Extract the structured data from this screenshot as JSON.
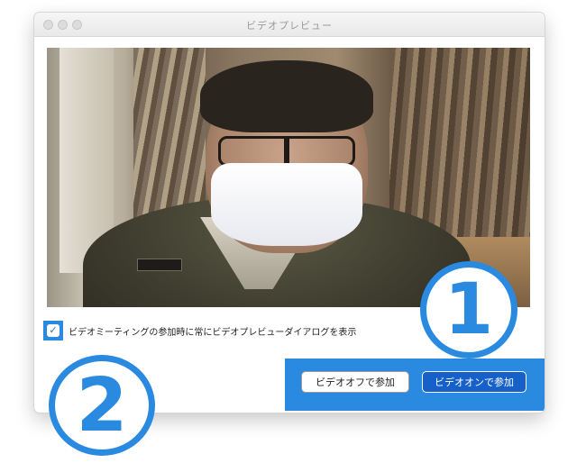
{
  "window": {
    "title": "ビデオプレビュー"
  },
  "preview": {
    "option_label": "ビデオミーティングの参加時に常にビデオプレビューダイアログを表示",
    "checked": true
  },
  "buttons": {
    "off_label": "ビデオオフで参加",
    "on_label": "ビデオオンで参加"
  },
  "callouts": {
    "one": "1",
    "two": "2",
    "accent": "#2a8ae0"
  },
  "icons": {
    "check": "checkmark-icon"
  }
}
